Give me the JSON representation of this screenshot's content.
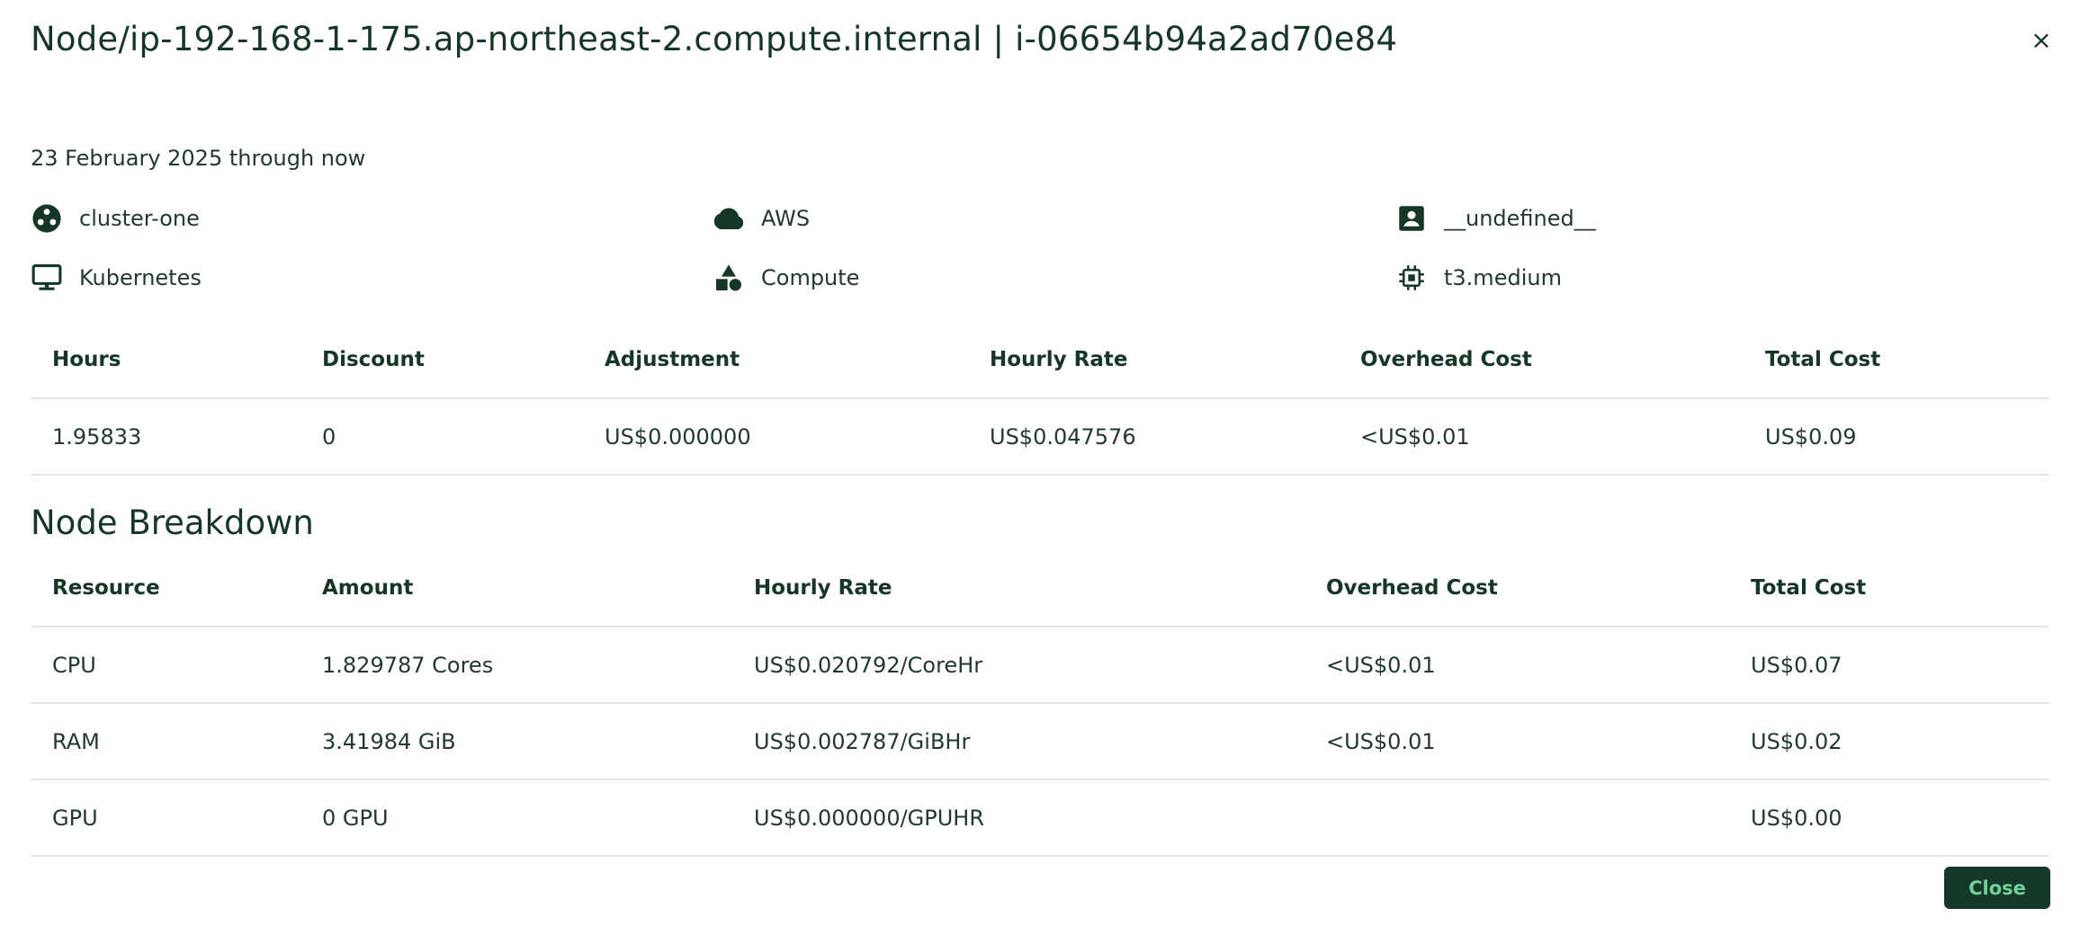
{
  "dialog": {
    "title": "Node/ip-192-168-1-175.ap-northeast-2.compute.internal | i-06654b94a2ad70e84",
    "close_icon": "×",
    "date_range": "23 February 2025 through now",
    "close_button_label": "Close"
  },
  "meta": {
    "cluster": {
      "icon": "cluster-icon",
      "label": "cluster-one"
    },
    "provider": {
      "icon": "cloud-icon",
      "label": "AWS"
    },
    "account": {
      "icon": "account-box-icon",
      "label": "__undefined__"
    },
    "platform": {
      "icon": "monitor-icon",
      "label": "Kubernetes"
    },
    "category": {
      "icon": "shapes-icon",
      "label": "Compute"
    },
    "instance_type": {
      "icon": "chip-icon",
      "label": "t3.medium"
    }
  },
  "summary_table": {
    "headers": [
      "Hours",
      "Discount",
      "Adjustment",
      "Hourly Rate",
      "Overhead Cost",
      "Total Cost"
    ],
    "row": [
      "1.95833",
      "0",
      "US$0.000000",
      "US$0.047576",
      "<US$0.01",
      "US$0.09"
    ]
  },
  "breakdown": {
    "title": "Node Breakdown",
    "headers": [
      "Resource",
      "Amount",
      "Hourly Rate",
      "Overhead Cost",
      "Total Cost"
    ],
    "rows": [
      [
        "CPU",
        "1.829787 Cores",
        "US$0.020792/CoreHr",
        "<US$0.01",
        "US$0.07"
      ],
      [
        "RAM",
        "3.41984 GiB",
        "US$0.002787/GiBHr",
        "<US$0.01",
        "US$0.02"
      ],
      [
        "GPU",
        "0 GPU",
        "US$0.000000/GPUHR",
        "",
        "US$0.00"
      ]
    ]
  },
  "colors": {
    "text": "#163626",
    "button_bg": "#163828",
    "button_text": "#6fd497",
    "divider": "#e3e6e4"
  }
}
